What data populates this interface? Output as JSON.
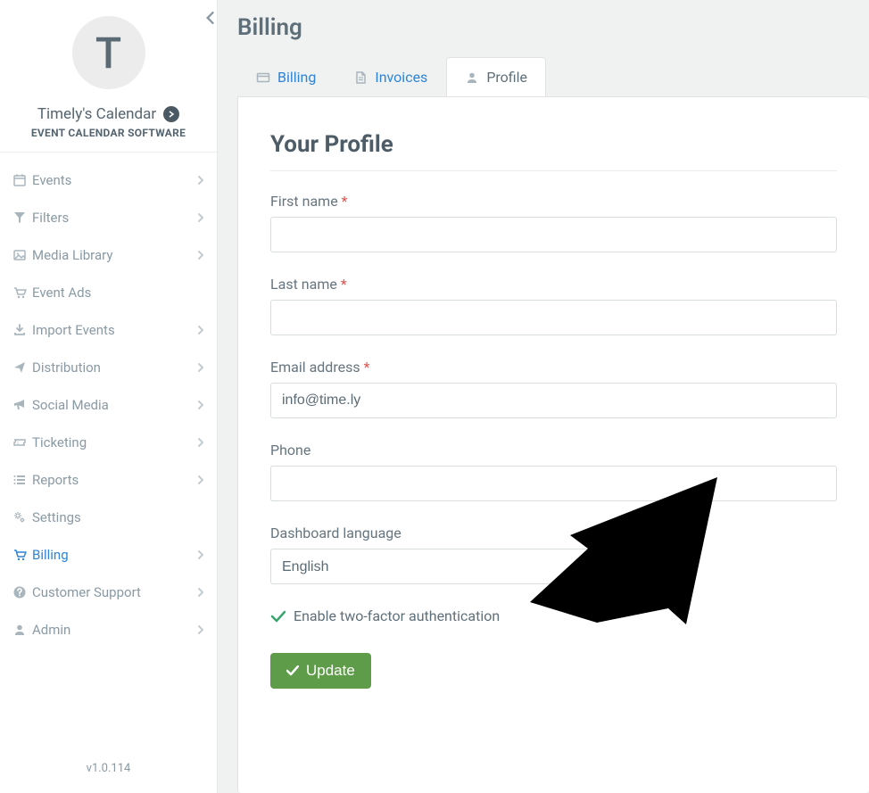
{
  "brand": {
    "avatar_letter": "T",
    "name": "Timely's Calendar",
    "tagline": "EVENT CALENDAR SOFTWARE"
  },
  "sidebar": {
    "items": [
      {
        "label": "Events",
        "icon": "calendar",
        "expandable": true
      },
      {
        "label": "Filters",
        "icon": "funnel",
        "expandable": true
      },
      {
        "label": "Media Library",
        "icon": "image",
        "expandable": true
      },
      {
        "label": "Event Ads",
        "icon": "cart",
        "expandable": false
      },
      {
        "label": "Import Events",
        "icon": "download",
        "expandable": true
      },
      {
        "label": "Distribution",
        "icon": "send",
        "expandable": true
      },
      {
        "label": "Social Media",
        "icon": "megaphone",
        "expandable": true
      },
      {
        "label": "Ticketing",
        "icon": "ticket",
        "expandable": true
      },
      {
        "label": "Reports",
        "icon": "list",
        "expandable": true
      },
      {
        "label": "Settings",
        "icon": "gears",
        "expandable": false
      },
      {
        "label": "Billing",
        "icon": "cart",
        "expandable": true,
        "active": true
      },
      {
        "label": "Customer Support",
        "icon": "question",
        "expandable": true
      },
      {
        "label": "Admin",
        "icon": "user",
        "expandable": true
      }
    ],
    "version": "v1.0.114"
  },
  "page": {
    "title": "Billing"
  },
  "tabs": [
    {
      "label": "Billing",
      "icon": "card"
    },
    {
      "label": "Invoices",
      "icon": "doc"
    },
    {
      "label": "Profile",
      "icon": "user",
      "active": true
    }
  ],
  "profile": {
    "heading": "Your Profile",
    "fields": {
      "first_name": {
        "label": "First name",
        "required": true,
        "value": ""
      },
      "last_name": {
        "label": "Last name",
        "required": true,
        "value": ""
      },
      "email": {
        "label": "Email address",
        "required": true,
        "value": "info@time.ly"
      },
      "phone": {
        "label": "Phone",
        "required": false,
        "value": ""
      },
      "language": {
        "label": "Dashboard language",
        "selected": "English"
      }
    },
    "twofa_label": "Enable two-factor authentication",
    "update_button": "Update"
  }
}
